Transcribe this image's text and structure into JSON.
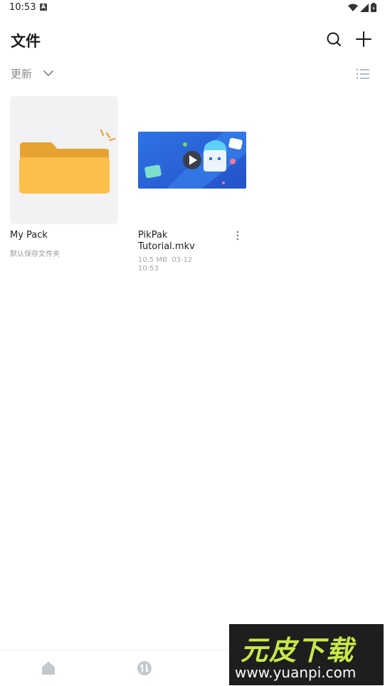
{
  "status_bar": {
    "time": "10:53",
    "notification_letter": "A"
  },
  "header": {
    "title": "文件"
  },
  "sort": {
    "label": "更新"
  },
  "items": [
    {
      "name": "My Pack",
      "subtitle": "默认保存文件夹",
      "type": "folder"
    },
    {
      "name": "PikPak Tutorial.mkv",
      "size": "10.5 MB",
      "date": "03-12 10:53",
      "type": "video"
    }
  ],
  "bottom_nav": [
    {
      "icon": "home-icon"
    },
    {
      "icon": "transfer-icon"
    },
    {
      "icon": "files-icon",
      "active": true
    }
  ],
  "watermark": {
    "title": "元皮下载",
    "url": "www.yuanpi.com"
  },
  "colors": {
    "folder": "#fcc04a",
    "folder_back": "#e6a331",
    "video_bg": "#2f6fe0",
    "accent": "#1a73e8"
  }
}
